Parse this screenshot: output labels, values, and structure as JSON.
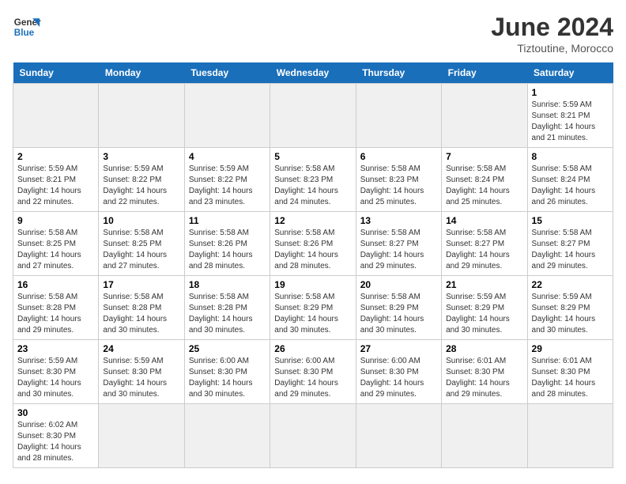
{
  "logo": {
    "line1": "General",
    "line2": "Blue"
  },
  "calendar": {
    "title": "June 2024",
    "subtitle": "Tiztoutine, Morocco",
    "headers": [
      "Sunday",
      "Monday",
      "Tuesday",
      "Wednesday",
      "Thursday",
      "Friday",
      "Saturday"
    ],
    "weeks": [
      [
        {
          "day": "",
          "info": ""
        },
        {
          "day": "",
          "info": ""
        },
        {
          "day": "",
          "info": ""
        },
        {
          "day": "",
          "info": ""
        },
        {
          "day": "",
          "info": ""
        },
        {
          "day": "",
          "info": ""
        },
        {
          "day": "1",
          "info": "Sunrise: 5:59 AM\nSunset: 8:21 PM\nDaylight: 14 hours\nand 21 minutes."
        }
      ],
      [
        {
          "day": "2",
          "info": "Sunrise: 5:59 AM\nSunset: 8:21 PM\nDaylight: 14 hours\nand 22 minutes."
        },
        {
          "day": "3",
          "info": "Sunrise: 5:59 AM\nSunset: 8:22 PM\nDaylight: 14 hours\nand 22 minutes."
        },
        {
          "day": "4",
          "info": "Sunrise: 5:59 AM\nSunset: 8:22 PM\nDaylight: 14 hours\nand 23 minutes."
        },
        {
          "day": "5",
          "info": "Sunrise: 5:58 AM\nSunset: 8:23 PM\nDaylight: 14 hours\nand 24 minutes."
        },
        {
          "day": "6",
          "info": "Sunrise: 5:58 AM\nSunset: 8:23 PM\nDaylight: 14 hours\nand 25 minutes."
        },
        {
          "day": "7",
          "info": "Sunrise: 5:58 AM\nSunset: 8:24 PM\nDaylight: 14 hours\nand 25 minutes."
        },
        {
          "day": "8",
          "info": "Sunrise: 5:58 AM\nSunset: 8:24 PM\nDaylight: 14 hours\nand 26 minutes."
        }
      ],
      [
        {
          "day": "9",
          "info": "Sunrise: 5:58 AM\nSunset: 8:25 PM\nDaylight: 14 hours\nand 27 minutes."
        },
        {
          "day": "10",
          "info": "Sunrise: 5:58 AM\nSunset: 8:25 PM\nDaylight: 14 hours\nand 27 minutes."
        },
        {
          "day": "11",
          "info": "Sunrise: 5:58 AM\nSunset: 8:26 PM\nDaylight: 14 hours\nand 28 minutes."
        },
        {
          "day": "12",
          "info": "Sunrise: 5:58 AM\nSunset: 8:26 PM\nDaylight: 14 hours\nand 28 minutes."
        },
        {
          "day": "13",
          "info": "Sunrise: 5:58 AM\nSunset: 8:27 PM\nDaylight: 14 hours\nand 29 minutes."
        },
        {
          "day": "14",
          "info": "Sunrise: 5:58 AM\nSunset: 8:27 PM\nDaylight: 14 hours\nand 29 minutes."
        },
        {
          "day": "15",
          "info": "Sunrise: 5:58 AM\nSunset: 8:27 PM\nDaylight: 14 hours\nand 29 minutes."
        }
      ],
      [
        {
          "day": "16",
          "info": "Sunrise: 5:58 AM\nSunset: 8:28 PM\nDaylight: 14 hours\nand 29 minutes."
        },
        {
          "day": "17",
          "info": "Sunrise: 5:58 AM\nSunset: 8:28 PM\nDaylight: 14 hours\nand 30 minutes."
        },
        {
          "day": "18",
          "info": "Sunrise: 5:58 AM\nSunset: 8:28 PM\nDaylight: 14 hours\nand 30 minutes."
        },
        {
          "day": "19",
          "info": "Sunrise: 5:58 AM\nSunset: 8:29 PM\nDaylight: 14 hours\nand 30 minutes."
        },
        {
          "day": "20",
          "info": "Sunrise: 5:58 AM\nSunset: 8:29 PM\nDaylight: 14 hours\nand 30 minutes."
        },
        {
          "day": "21",
          "info": "Sunrise: 5:59 AM\nSunset: 8:29 PM\nDaylight: 14 hours\nand 30 minutes."
        },
        {
          "day": "22",
          "info": "Sunrise: 5:59 AM\nSunset: 8:29 PM\nDaylight: 14 hours\nand 30 minutes."
        }
      ],
      [
        {
          "day": "23",
          "info": "Sunrise: 5:59 AM\nSunset: 8:30 PM\nDaylight: 14 hours\nand 30 minutes."
        },
        {
          "day": "24",
          "info": "Sunrise: 5:59 AM\nSunset: 8:30 PM\nDaylight: 14 hours\nand 30 minutes."
        },
        {
          "day": "25",
          "info": "Sunrise: 6:00 AM\nSunset: 8:30 PM\nDaylight: 14 hours\nand 30 minutes."
        },
        {
          "day": "26",
          "info": "Sunrise: 6:00 AM\nSunset: 8:30 PM\nDaylight: 14 hours\nand 29 minutes."
        },
        {
          "day": "27",
          "info": "Sunrise: 6:00 AM\nSunset: 8:30 PM\nDaylight: 14 hours\nand 29 minutes."
        },
        {
          "day": "28",
          "info": "Sunrise: 6:01 AM\nSunset: 8:30 PM\nDaylight: 14 hours\nand 29 minutes."
        },
        {
          "day": "29",
          "info": "Sunrise: 6:01 AM\nSunset: 8:30 PM\nDaylight: 14 hours\nand 28 minutes."
        }
      ],
      [
        {
          "day": "30",
          "info": "Sunrise: 6:02 AM\nSunset: 8:30 PM\nDaylight: 14 hours\nand 28 minutes."
        },
        {
          "day": "",
          "info": ""
        },
        {
          "day": "",
          "info": ""
        },
        {
          "day": "",
          "info": ""
        },
        {
          "day": "",
          "info": ""
        },
        {
          "day": "",
          "info": ""
        },
        {
          "day": "",
          "info": ""
        }
      ]
    ]
  }
}
